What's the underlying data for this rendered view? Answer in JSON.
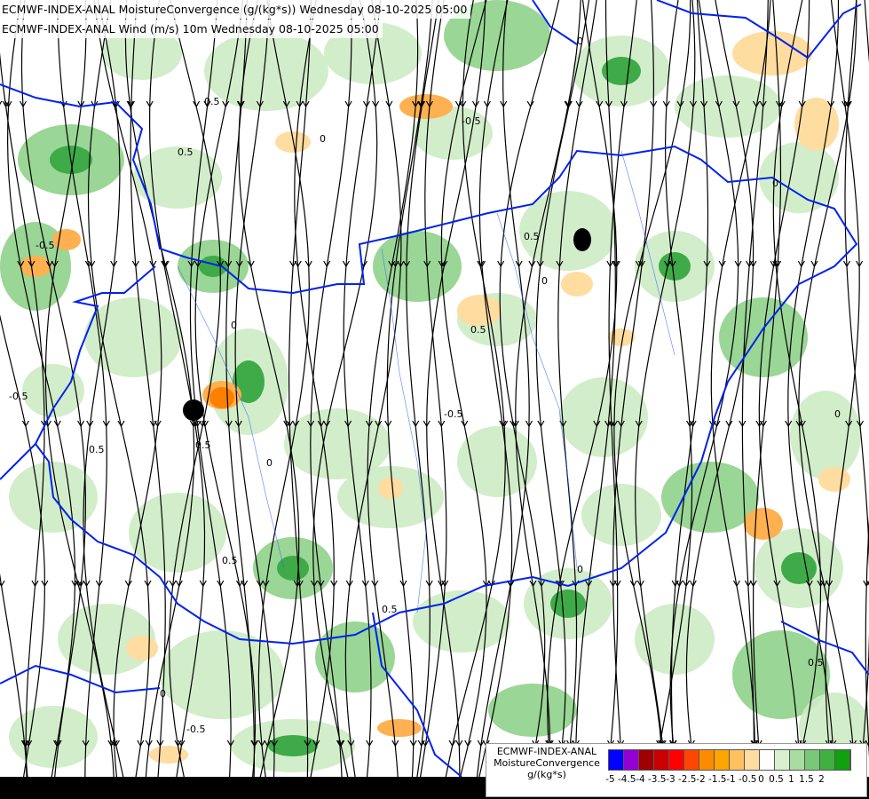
{
  "header": {
    "line1": "ECMWF-INDEX-ANAL MoistureConvergence (g/(kg*s)) Wednesday 08-10-2025 05:00",
    "line2": "ECMWF-INDEX-ANAL Wind (m/s) 10m Wednesday 08-10-2025 05:00"
  },
  "legend": {
    "title": [
      "ECMWF-INDEX-ANAL",
      "MoistureConvergence",
      "g/(kg*s)"
    ],
    "colors": [
      "#0000ff",
      "#9400d3",
      "#a00000",
      "#c80000",
      "#ff0000",
      "#ff4500",
      "#ff8c00",
      "#ffa500",
      "#ffc060",
      "#ffdca0",
      "#ffffff",
      "#d8f0d0",
      "#a8dca0",
      "#78c878",
      "#40b040",
      "#10a010"
    ],
    "ticks": [
      "-5",
      "-4.5",
      "-4",
      "-3.5",
      "-3",
      "-2.5",
      "-2",
      "-1.5",
      "-1",
      "-0.5",
      "0",
      "0.5",
      "1",
      "1.5",
      "2"
    ]
  },
  "map": {
    "contour_labels": [
      "0",
      "0.5",
      "-0.5",
      "0",
      "0.5",
      "0",
      "-0.5",
      "0.5",
      "0",
      "0.5",
      "0",
      "-0.5",
      "0.5",
      "0",
      "0.5",
      "-0.5",
      "0",
      "0.5",
      "0.5",
      "0",
      "-0.5",
      "0.5",
      "0"
    ],
    "colors": {
      "border": "#0022ee",
      "river": "#3060ff",
      "streamline": "#000000",
      "green_light": "#cdebc4",
      "green_mid": "#8fd28a",
      "green_dark": "#3faa48",
      "orange_light": "#ffdca0",
      "orange_mid": "#ffb050",
      "orange_dark": "#ff8000"
    }
  }
}
